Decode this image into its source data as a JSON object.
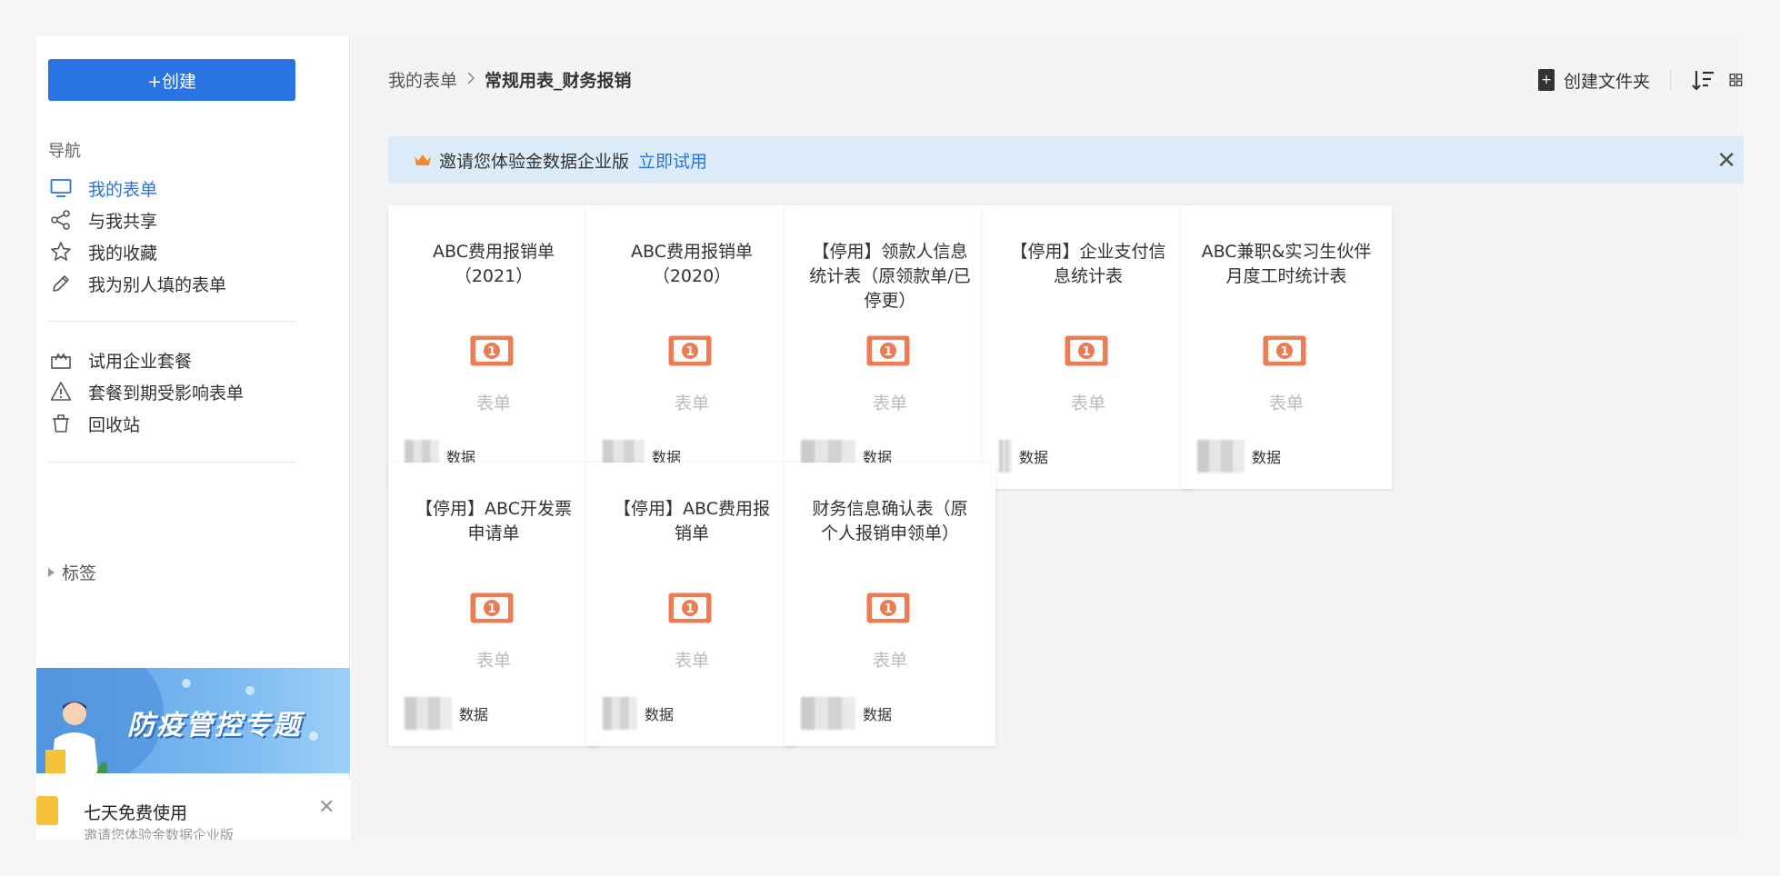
{
  "sidebar": {
    "create_label": "+创建",
    "nav_heading": "导航",
    "nav_items": [
      {
        "label": "我的表单",
        "icon": "monitor-icon",
        "active": true
      },
      {
        "label": "与我共享",
        "icon": "share-icon",
        "active": false
      },
      {
        "label": "我的收藏",
        "icon": "star-icon",
        "active": false
      },
      {
        "label": "我为别人填的表单",
        "icon": "pencil-icon",
        "active": false
      }
    ],
    "extra_items": [
      {
        "label": "试用企业套餐",
        "icon": "crown-box-icon"
      },
      {
        "label": "套餐到期受影响表单",
        "icon": "warning-icon"
      },
      {
        "label": "回收站",
        "icon": "trash-icon"
      }
    ],
    "tags_label": "标签",
    "banner_title": "防疫管控专题",
    "promo": {
      "title": "七天免费使用",
      "subtitle": "邀请您体验金数据企业版"
    }
  },
  "header": {
    "breadcrumb_root": "我的表单",
    "breadcrumb_current": "常规用表_财务报销",
    "create_folder_label": "创建文件夹"
  },
  "notice": {
    "text": "邀请您体验金数据企业版",
    "link": "立即试用"
  },
  "cards": [
    {
      "title": "ABC费用报销单（2021）",
      "type": "表单",
      "footer": "数据"
    },
    {
      "title": "ABC费用报销单（2020）",
      "type": "表单",
      "footer": "数据"
    },
    {
      "title": "【停用】领款人信息统计表（原领款单/已停更）",
      "type": "表单",
      "footer": "数据"
    },
    {
      "title": "【停用】企业支付信息统计表",
      "type": "表单",
      "footer": "数据"
    },
    {
      "title": "ABC兼职&实习生伙伴月度工时统计表",
      "type": "表单",
      "footer": "数据"
    },
    {
      "title": "【停用】ABC开发票申请单",
      "type": "表单",
      "footer": "数据"
    },
    {
      "title": "【停用】ABC费用报销单",
      "type": "表单",
      "footer": "数据"
    },
    {
      "title": "财务信息确认表（原个人报销申领单）",
      "type": "表单",
      "footer": "数据"
    }
  ],
  "colors": {
    "primary": "#2a73e3",
    "notice_bg": "#dcebfa",
    "money_icon": "#ef7b52"
  }
}
